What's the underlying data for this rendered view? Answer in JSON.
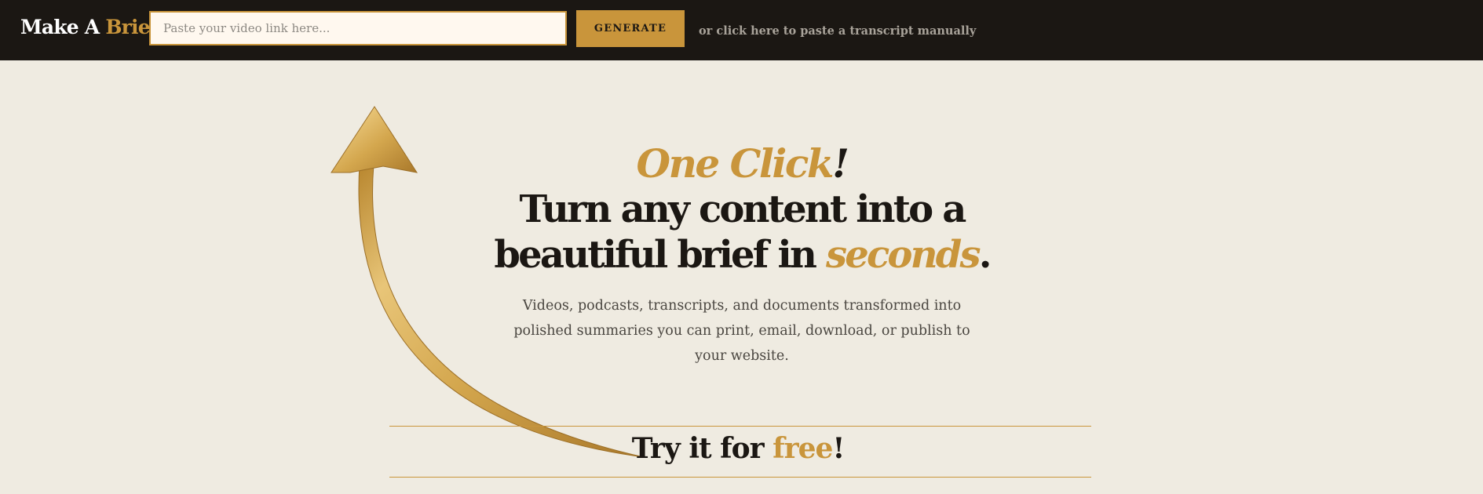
{
  "header": {
    "logo_part1": "Make A ",
    "logo_part2": "Brief",
    "input_placeholder": "Paste your video link here...",
    "generate_label": "GENERATE",
    "manual_link": "or click here to paste a transcript manually"
  },
  "hero": {
    "tagline_main": "One Click",
    "tagline_end": "!",
    "headline_line1": "Turn any content into a",
    "headline_line2a": "beautiful brief in ",
    "headline_accent": "seconds",
    "headline_end": ".",
    "subtext": "Videos, podcasts, transcripts, and documents transformed into polished summaries you can print, email, download, or publish to your website."
  },
  "cta": {
    "try_part1": "Try it for ",
    "try_accent": "free",
    "try_end": "!"
  },
  "colors": {
    "accent": "#c9953b",
    "dark": "#1b1713",
    "background": "#efebe1"
  },
  "icons": {
    "arrow": "curved-up-arrow-icon"
  }
}
